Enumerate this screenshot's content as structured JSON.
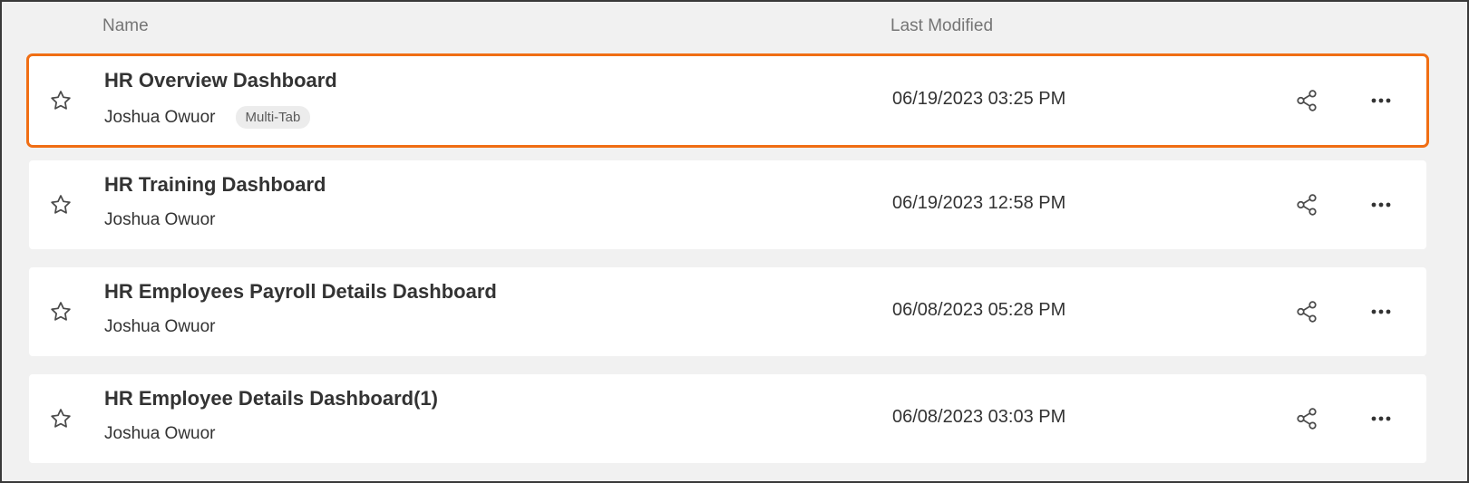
{
  "header": {
    "name_label": "Name",
    "modified_label": "Last Modified"
  },
  "rows": [
    {
      "title": "HR Overview Dashboard",
      "owner": "Joshua Owuor",
      "tag": "Multi-Tab",
      "modified": "06/19/2023 03:25 PM",
      "selected": true
    },
    {
      "title": "HR Training Dashboard",
      "owner": "Joshua Owuor",
      "tag": "",
      "modified": "06/19/2023 12:58 PM",
      "selected": false
    },
    {
      "title": "HR Employees Payroll Details Dashboard",
      "owner": "Joshua Owuor",
      "tag": "",
      "modified": "06/08/2023 05:28 PM",
      "selected": false
    },
    {
      "title": "HR Employee Details Dashboard(1)",
      "owner": "Joshua Owuor",
      "tag": "",
      "modified": "06/08/2023 03:03 PM",
      "selected": false
    }
  ],
  "icons": {
    "favorite": "star-outline-icon",
    "share": "share-icon",
    "more": "more-horizontal-icon"
  },
  "colors": {
    "selection_outline": "#f06e14",
    "background": "#f1f1f1",
    "row_background": "#ffffff"
  }
}
